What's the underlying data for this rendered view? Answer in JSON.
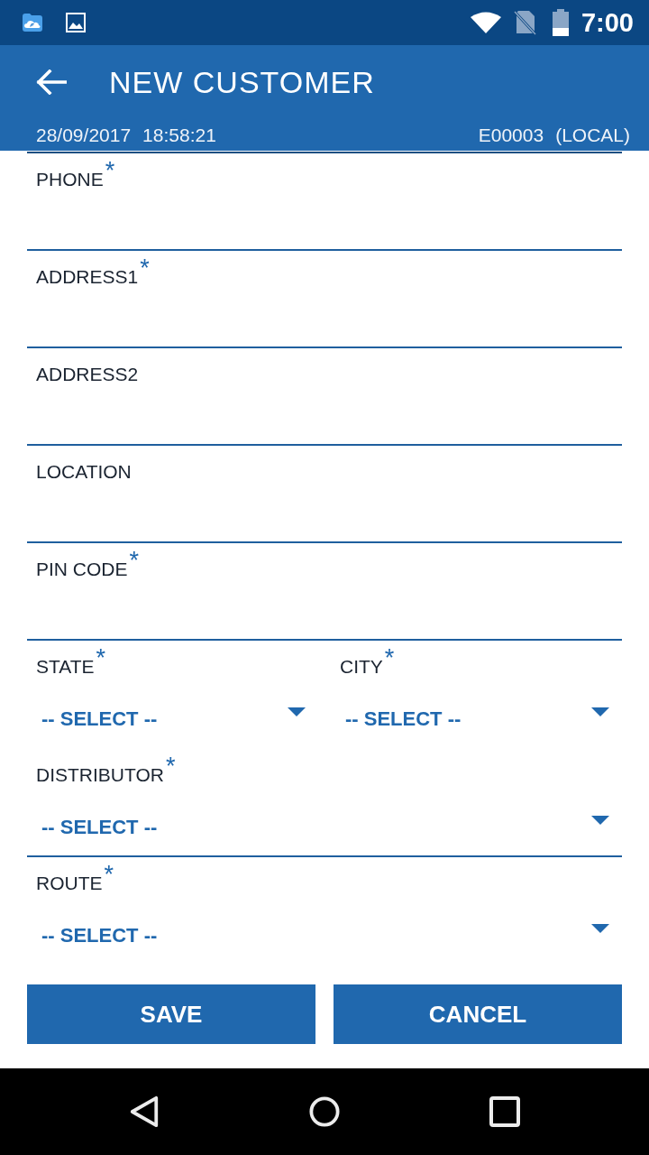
{
  "status_bar": {
    "time": "7:00"
  },
  "app_bar": {
    "title": "NEW CUSTOMER",
    "date": "28/09/2017",
    "time": "18:58:21",
    "record_id": "E00003",
    "source": "(LOCAL)"
  },
  "form": {
    "rows": [
      {
        "fields": [
          {
            "kind": "text",
            "label": "PHONE",
            "required_mark": "*",
            "underline": true
          }
        ]
      },
      {
        "fields": [
          {
            "kind": "text",
            "label": "ADDRESS1",
            "required_mark": "*",
            "underline": true
          }
        ]
      },
      {
        "fields": [
          {
            "kind": "text",
            "label": "ADDRESS2",
            "underline": true
          }
        ]
      },
      {
        "fields": [
          {
            "kind": "text",
            "label": "LOCATION",
            "underline": true
          }
        ]
      },
      {
        "fields": [
          {
            "kind": "text",
            "label": "PIN CODE",
            "required_mark": "*",
            "underline": true
          }
        ]
      },
      {
        "fields": [
          {
            "kind": "select",
            "label": "STATE",
            "required_mark": "*",
            "value": "-- SELECT --",
            "underline": false
          },
          {
            "kind": "select",
            "label": "CITY",
            "required_mark": "*",
            "value": "-- SELECT --",
            "underline": false
          }
        ]
      },
      {
        "fields": [
          {
            "kind": "select",
            "label": "DISTRIBUTOR",
            "required_mark": "*",
            "value": "-- SELECT --",
            "underline": true
          }
        ]
      },
      {
        "fields": [
          {
            "kind": "select",
            "label": "ROUTE",
            "required_mark": "*",
            "value": "-- SELECT --",
            "underline": false
          }
        ]
      }
    ]
  },
  "buttons": [
    {
      "label": "SAVE"
    },
    {
      "label": "CANCEL"
    }
  ]
}
